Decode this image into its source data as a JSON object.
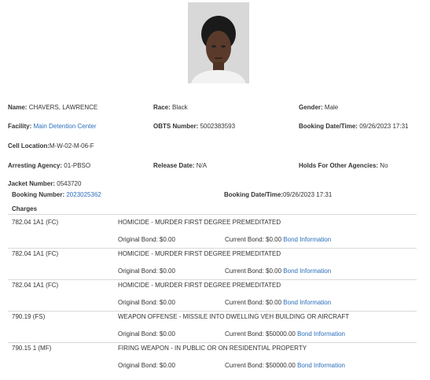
{
  "inmate": {
    "name_label": "Name:",
    "name": "CHAVERS, LAWRENCE",
    "race_label": "Race:",
    "race": "Black",
    "gender_label": "Gender:",
    "gender": "Male",
    "facility_label": "Facility:",
    "facility": "Main Detention Center",
    "obts_label": "OBTS Number:",
    "obts": "5002383593",
    "booking_dt_label": "Booking Date/Time:",
    "booking_dt": "09/26/2023 17:31",
    "cell_label": "Cell Location:",
    "cell": "M-W-02-M-06-F",
    "agency_label": "Arresting Agency:",
    "agency": "01-PBSO",
    "release_label": "Release Date:",
    "release": "N/A",
    "holds_label": "Holds For Other Agencies:",
    "holds": "No",
    "jacket_label": "Jacket Number:",
    "jacket": "0543720"
  },
  "booking": {
    "number_label": "Booking Number:",
    "number": "2023025362",
    "datetime_label": "Booking Date/Time:",
    "datetime": "09/26/2023 17:31",
    "charges_heading": "Charges"
  },
  "charges": [
    {
      "code": "782.04 1A1 (FC)",
      "description": "HOMICIDE - MURDER FIRST DEGREE PREMEDITATED",
      "original_bond": "Original Bond: $0.00",
      "current_bond": "Current Bond: $0.00",
      "bond_link": "Bond Information"
    },
    {
      "code": "782.04 1A1 (FC)",
      "description": "HOMICIDE - MURDER FIRST DEGREE PREMEDITATED",
      "original_bond": "Original Bond: $0.00",
      "current_bond": "Current Bond: $0.00",
      "bond_link": "Bond Information"
    },
    {
      "code": "782.04 1A1 (FC)",
      "description": "HOMICIDE - MURDER FIRST DEGREE PREMEDITATED",
      "original_bond": "Original Bond: $0.00",
      "current_bond": "Current Bond: $0.00",
      "bond_link": "Bond Information"
    },
    {
      "code": "790.19 (FS)",
      "description": "WEAPON OFFENSE - MISSILE INTO DWELLING VEH BUILDING OR AIRCRAFT",
      "original_bond": "Original Bond: $0.00",
      "current_bond": "Current Bond: $50000.00",
      "bond_link": "Bond Information"
    },
    {
      "code": "790.15 1 (MF)",
      "description": "FIRING WEAPON - IN PUBLIC OR ON RESIDENTIAL PROPERTY",
      "original_bond": "Original Bond: $0.00",
      "current_bond": "Current Bond: $50000.00",
      "bond_link": "Bond Information"
    }
  ],
  "colors": {
    "link": "#2a6ebb",
    "text": "#333333",
    "divider": "#d9d9d9"
  },
  "icons": {
    "photo": "mugshot-photo"
  }
}
